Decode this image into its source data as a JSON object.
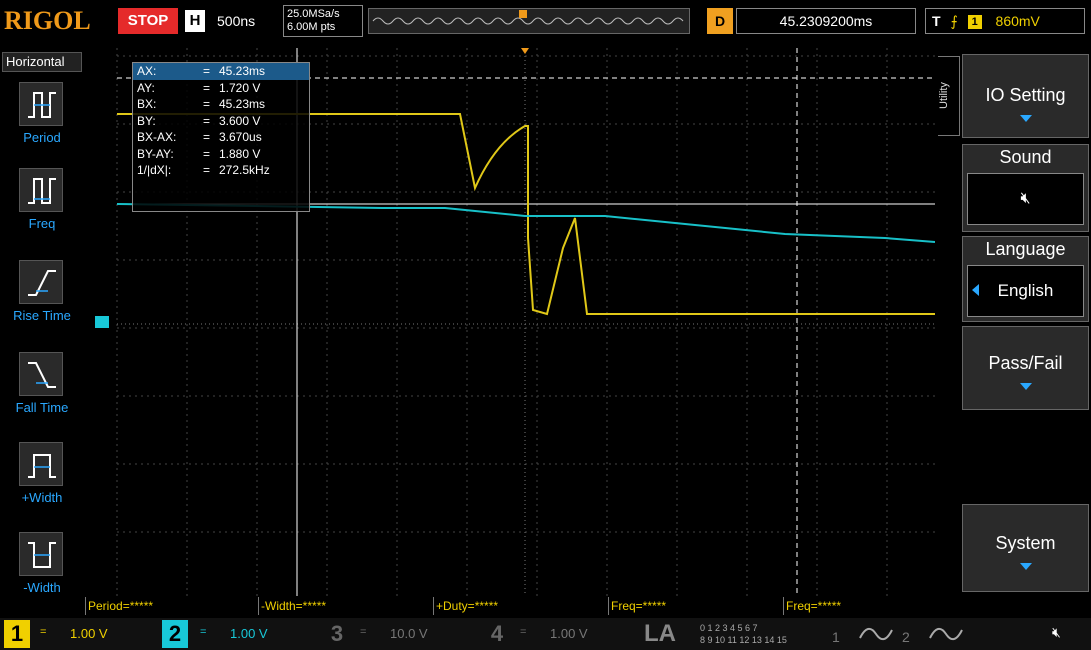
{
  "top": {
    "brand": "RIGOL",
    "run_state": "STOP",
    "timebase_label": "H",
    "timebase_value": "500ns",
    "sample_rate": "25.0MSa/s",
    "memory_depth": "6.00M pts",
    "delay_label": "D",
    "delay_value": "45.2309200ms",
    "trigger_label": "T",
    "trigger_source": "1",
    "trigger_level": "860mV"
  },
  "left_menu": {
    "title": "Horizontal",
    "items": [
      {
        "label": "Period",
        "icon": "period-icon"
      },
      {
        "label": "Freq",
        "icon": "freq-icon"
      },
      {
        "label": "Rise Time",
        "icon": "rise-time-icon"
      },
      {
        "label": "Fall Time",
        "icon": "fall-time-icon"
      },
      {
        "label": "+Width",
        "icon": "pos-width-icon"
      },
      {
        "label": "-Width",
        "icon": "neg-width-icon"
      }
    ]
  },
  "cursor_table": [
    {
      "key": "AX:",
      "eq": "=",
      "value": "45.23ms"
    },
    {
      "key": "AY:",
      "eq": "=",
      "value": "1.720 V"
    },
    {
      "key": "BX:",
      "eq": "=",
      "value": "45.23ms"
    },
    {
      "key": "BY:",
      "eq": "=",
      "value": "3.600 V"
    },
    {
      "key": "BX-AX:",
      "eq": "=",
      "value": "3.670us"
    },
    {
      "key": "BY-AY:",
      "eq": "=",
      "value": "1.880 V"
    },
    {
      "key": "1/|dX|:",
      "eq": "=",
      "value": "272.5kHz"
    }
  ],
  "measure_strip": [
    "Period=*****",
    "-Width=*****",
    "+Duty=*****",
    "Freq=*****",
    "Freq=*****"
  ],
  "right_menu": {
    "tab": "Utility",
    "buttons": [
      {
        "label": "IO Setting"
      },
      {
        "label": "Sound"
      },
      {
        "label": "Language",
        "value": "English"
      },
      {
        "label": "Pass/Fail"
      },
      {
        "label": "System"
      }
    ]
  },
  "channels": [
    {
      "num": "1",
      "coupling": "=",
      "scale": "1.00 V",
      "color": "#f0d000",
      "active": true
    },
    {
      "num": "2",
      "coupling": "=",
      "scale": "1.00 V",
      "color": "#18c8d8",
      "active": true
    },
    {
      "num": "3",
      "coupling": "=",
      "scale": "10.0 V",
      "color": "#555555",
      "active": false
    },
    {
      "num": "4",
      "coupling": "=",
      "scale": "1.00 V",
      "color": "#555555",
      "active": false
    }
  ],
  "la_label": "LA",
  "la_digits_top": [
    "0",
    "1",
    "2",
    "3",
    "4",
    "5",
    "6",
    "7"
  ],
  "la_digits_bot": [
    "8",
    "9",
    "10",
    "11",
    "12",
    "13",
    "14",
    "15"
  ],
  "colors": {
    "ch1": "#f0d000",
    "ch2": "#18c8d8",
    "accent": "#2aa8ff",
    "trigger": "#f09a1a"
  }
}
